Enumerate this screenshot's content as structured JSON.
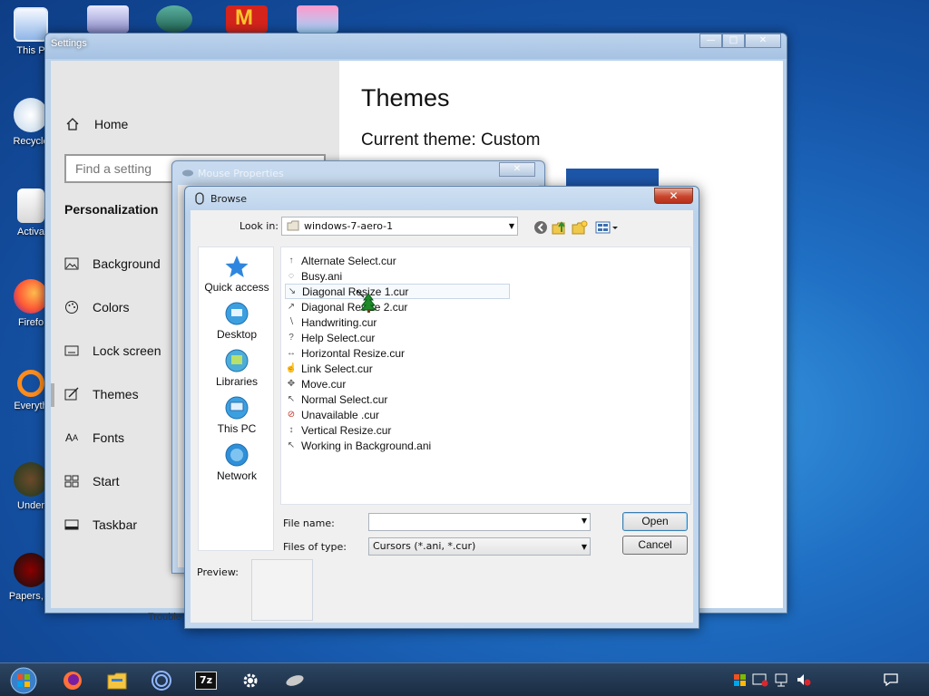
{
  "desktop": {
    "icons": [
      {
        "label": "This P",
        "icon": "computer-icon"
      },
      {
        "label": "Recycle",
        "icon": "recycle-bin-icon"
      },
      {
        "label": "Activa",
        "icon": "document-icon"
      },
      {
        "label": "Firefo",
        "icon": "firefox-icon"
      },
      {
        "label": "Everyth",
        "icon": "search-icon"
      },
      {
        "label": "Under",
        "icon": "game-icon"
      },
      {
        "label": "Papers, P",
        "icon": "game-icon"
      }
    ]
  },
  "settings": {
    "title": "Settings",
    "home_label": "Home",
    "search_placeholder": "Find a setting",
    "section_label": "Personalization",
    "nav_items": [
      {
        "label": "Background",
        "icon": "image-icon"
      },
      {
        "label": "Colors",
        "icon": "palette-icon"
      },
      {
        "label": "Lock screen",
        "icon": "lock-screen-icon"
      },
      {
        "label": "Themes",
        "icon": "brush-icon"
      },
      {
        "label": "Fonts",
        "icon": "font-icon"
      },
      {
        "label": "Start",
        "icon": "start-grid-icon"
      },
      {
        "label": "Taskbar",
        "icon": "taskbar-icon"
      }
    ],
    "selected_item": "Themes",
    "heading": "Themes",
    "current_theme": "Current theme: Custom",
    "peek_text": "Trouble"
  },
  "mouse_properties": {
    "title": "Mouse Properties"
  },
  "browse": {
    "title": "Browse",
    "look_in_label": "Look in:",
    "look_in_value": "windows-7-aero-1",
    "places": [
      {
        "label": "Quick access",
        "icon": "star-icon"
      },
      {
        "label": "Desktop",
        "icon": "desktop-icon"
      },
      {
        "label": "Libraries",
        "icon": "libraries-icon"
      },
      {
        "label": "This PC",
        "icon": "computer-icon"
      },
      {
        "label": "Network",
        "icon": "network-icon"
      }
    ],
    "files": [
      "Alternate Select.cur",
      "Busy.ani",
      "Diagonal Resize 1.cur",
      "Diagonal Resize 2.cur",
      "Handwriting.cur",
      "Help Select.cur",
      "Horizontal Resize.cur",
      "Link Select.cur",
      "Move.cur",
      "Normal Select.cur",
      "Unavailable .cur",
      "Vertical Resize.cur",
      "Working in Background.ani"
    ],
    "selected_file": "Diagonal Resize 1.cur",
    "file_name_label": "File name:",
    "file_name_value": "",
    "files_of_type_label": "Files of type:",
    "files_of_type_value": "Cursors (*.ani, *.cur)",
    "open_label": "Open",
    "cancel_label": "Cancel",
    "preview_label": "Preview:"
  },
  "taskbar": {
    "items": [
      "start-orb-icon",
      "firefox-icon",
      "file-explorer-icon",
      "app-icon",
      "7zip-icon",
      "settings-gear-icon",
      "mouse-icon"
    ],
    "tray": [
      "flag-icon",
      "security-icon",
      "network-icon",
      "volume-muted-icon",
      "notification-icon"
    ]
  },
  "colors": {
    "accent": "#1f6fc4",
    "close_red": "#c9452c",
    "selection": "#c8d6e8"
  }
}
